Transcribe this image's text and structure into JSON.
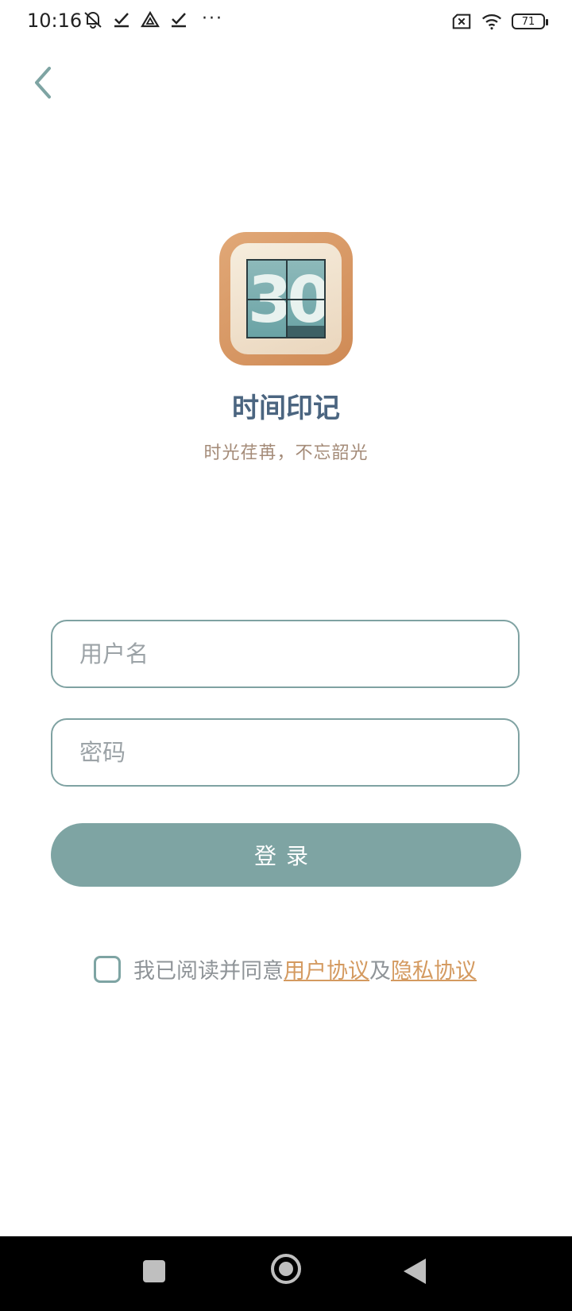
{
  "status_bar": {
    "time": "10:16",
    "battery": "71",
    "icons_left": [
      "mute-icon",
      "check-icon",
      "drive-icon",
      "check-icon",
      "more-icon"
    ],
    "icons_right": [
      "sim-off-icon",
      "wifi-icon",
      "battery-icon"
    ],
    "more": "···"
  },
  "app": {
    "name": "时间印记",
    "slogan": "时光荏苒，不忘韶光",
    "logo_digits": "30"
  },
  "form": {
    "username_placeholder": "用户名",
    "username_value": "",
    "password_placeholder": "密码",
    "password_value": "",
    "login_label": "登录"
  },
  "agreement": {
    "checked": false,
    "prefix": "我已阅读并同意",
    "user_agreement": "用户协议",
    "and": "及",
    "privacy_agreement": "隐私协议"
  },
  "colors": {
    "accent": "#7ea4a3",
    "title": "#4b6580",
    "slogan": "#a48b78",
    "link": "#d49a60"
  }
}
